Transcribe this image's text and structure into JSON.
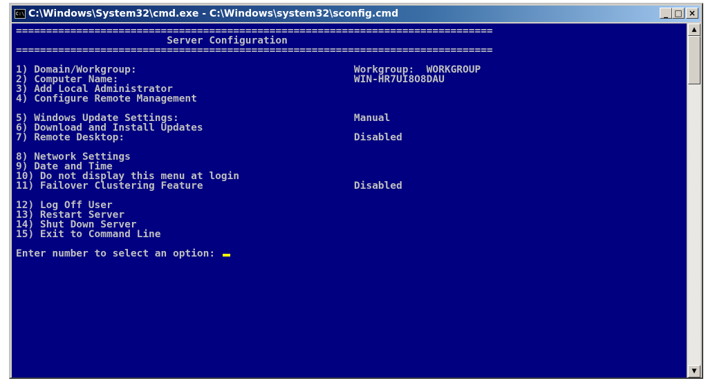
{
  "window": {
    "title": "C:\\Windows\\System32\\cmd.exe - C:\\Windows\\system32\\sconfig.cmd",
    "icon_label": "C:\\",
    "minimize_icon": "minimize-icon",
    "maximize_icon": "maximize-icon",
    "close_icon": "close-icon",
    "minimize_glyph": "_",
    "maximize_glyph": "□",
    "close_glyph": "×"
  },
  "console": {
    "background": "#000080",
    "foreground": "#c0c0c0",
    "separator": "===============================================================================",
    "heading": "                         Server Configuration",
    "menu_groups": [
      [
        {
          "label": "1) Domain/Workgroup:",
          "value": "Workgroup:  WORKGROUP"
        },
        {
          "label": "2) Computer Name:",
          "value": "WIN-HR7UI8O8DAU"
        },
        {
          "label": "3) Add Local Administrator",
          "value": ""
        },
        {
          "label": "4) Configure Remote Management",
          "value": ""
        }
      ],
      [
        {
          "label": "5) Windows Update Settings:",
          "value": "Manual"
        },
        {
          "label": "6) Download and Install Updates",
          "value": ""
        },
        {
          "label": "7) Remote Desktop:",
          "value": "Disabled"
        }
      ],
      [
        {
          "label": "8) Network Settings",
          "value": ""
        },
        {
          "label": "9) Date and Time",
          "value": ""
        },
        {
          "label": "10) Do not display this menu at login",
          "value": ""
        },
        {
          "label": "11) Failover Clustering Feature",
          "value": "Disabled"
        }
      ],
      [
        {
          "label": "12) Log Off User",
          "value": ""
        },
        {
          "label": "13) Restart Server",
          "value": ""
        },
        {
          "label": "14) Shut Down Server",
          "value": ""
        },
        {
          "label": "15) Exit to Command Line",
          "value": ""
        }
      ]
    ],
    "prompt": "Enter number to select an option: ",
    "cursor_color": "#ffff00"
  },
  "scrollbar": {
    "up_icon": "scroll-up-arrow-icon",
    "down_icon": "scroll-down-arrow-icon",
    "up_glyph": "▲",
    "down_glyph": "▼"
  }
}
